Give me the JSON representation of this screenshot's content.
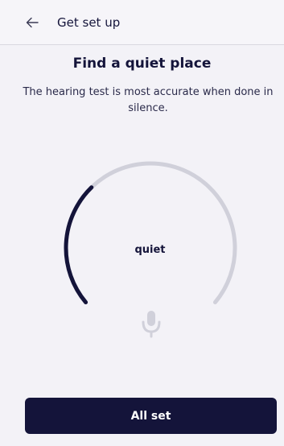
{
  "header": {
    "back_icon": "arrow-left-icon",
    "title": "Get set up"
  },
  "main": {
    "title": "Find a quiet place",
    "subtitle": "The hearing test is most accurate when done in silence.",
    "noise_meter": {
      "level_label": "quiet",
      "level": 0.33,
      "track_color": "#d0d0da",
      "fill_color": "#14143a",
      "mic_icon": "microphone-icon"
    }
  },
  "footer": {
    "button_label": "All set"
  },
  "colors": {
    "background": "#f3f2f7",
    "primary": "#14143a"
  }
}
